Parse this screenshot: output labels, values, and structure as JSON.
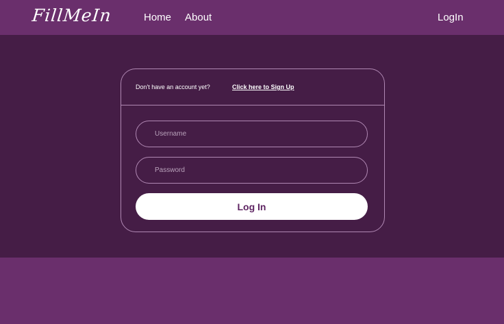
{
  "nav": {
    "logo": "FillMeIn",
    "links": [
      {
        "label": "Home"
      },
      {
        "label": "About"
      }
    ],
    "login_label": "LogIn"
  },
  "card": {
    "signup_prompt": "Don't have an account yet?",
    "signup_link": "Click here to Sign Up",
    "username_placeholder": "Username",
    "password_placeholder": "Password",
    "login_button": "Log In"
  },
  "colors": {
    "nav_bg": "#6a2f6c",
    "hero_bg": "#451d46",
    "border": "#b189b4",
    "button_bg": "#ffffff",
    "button_text": "#5e2462"
  }
}
